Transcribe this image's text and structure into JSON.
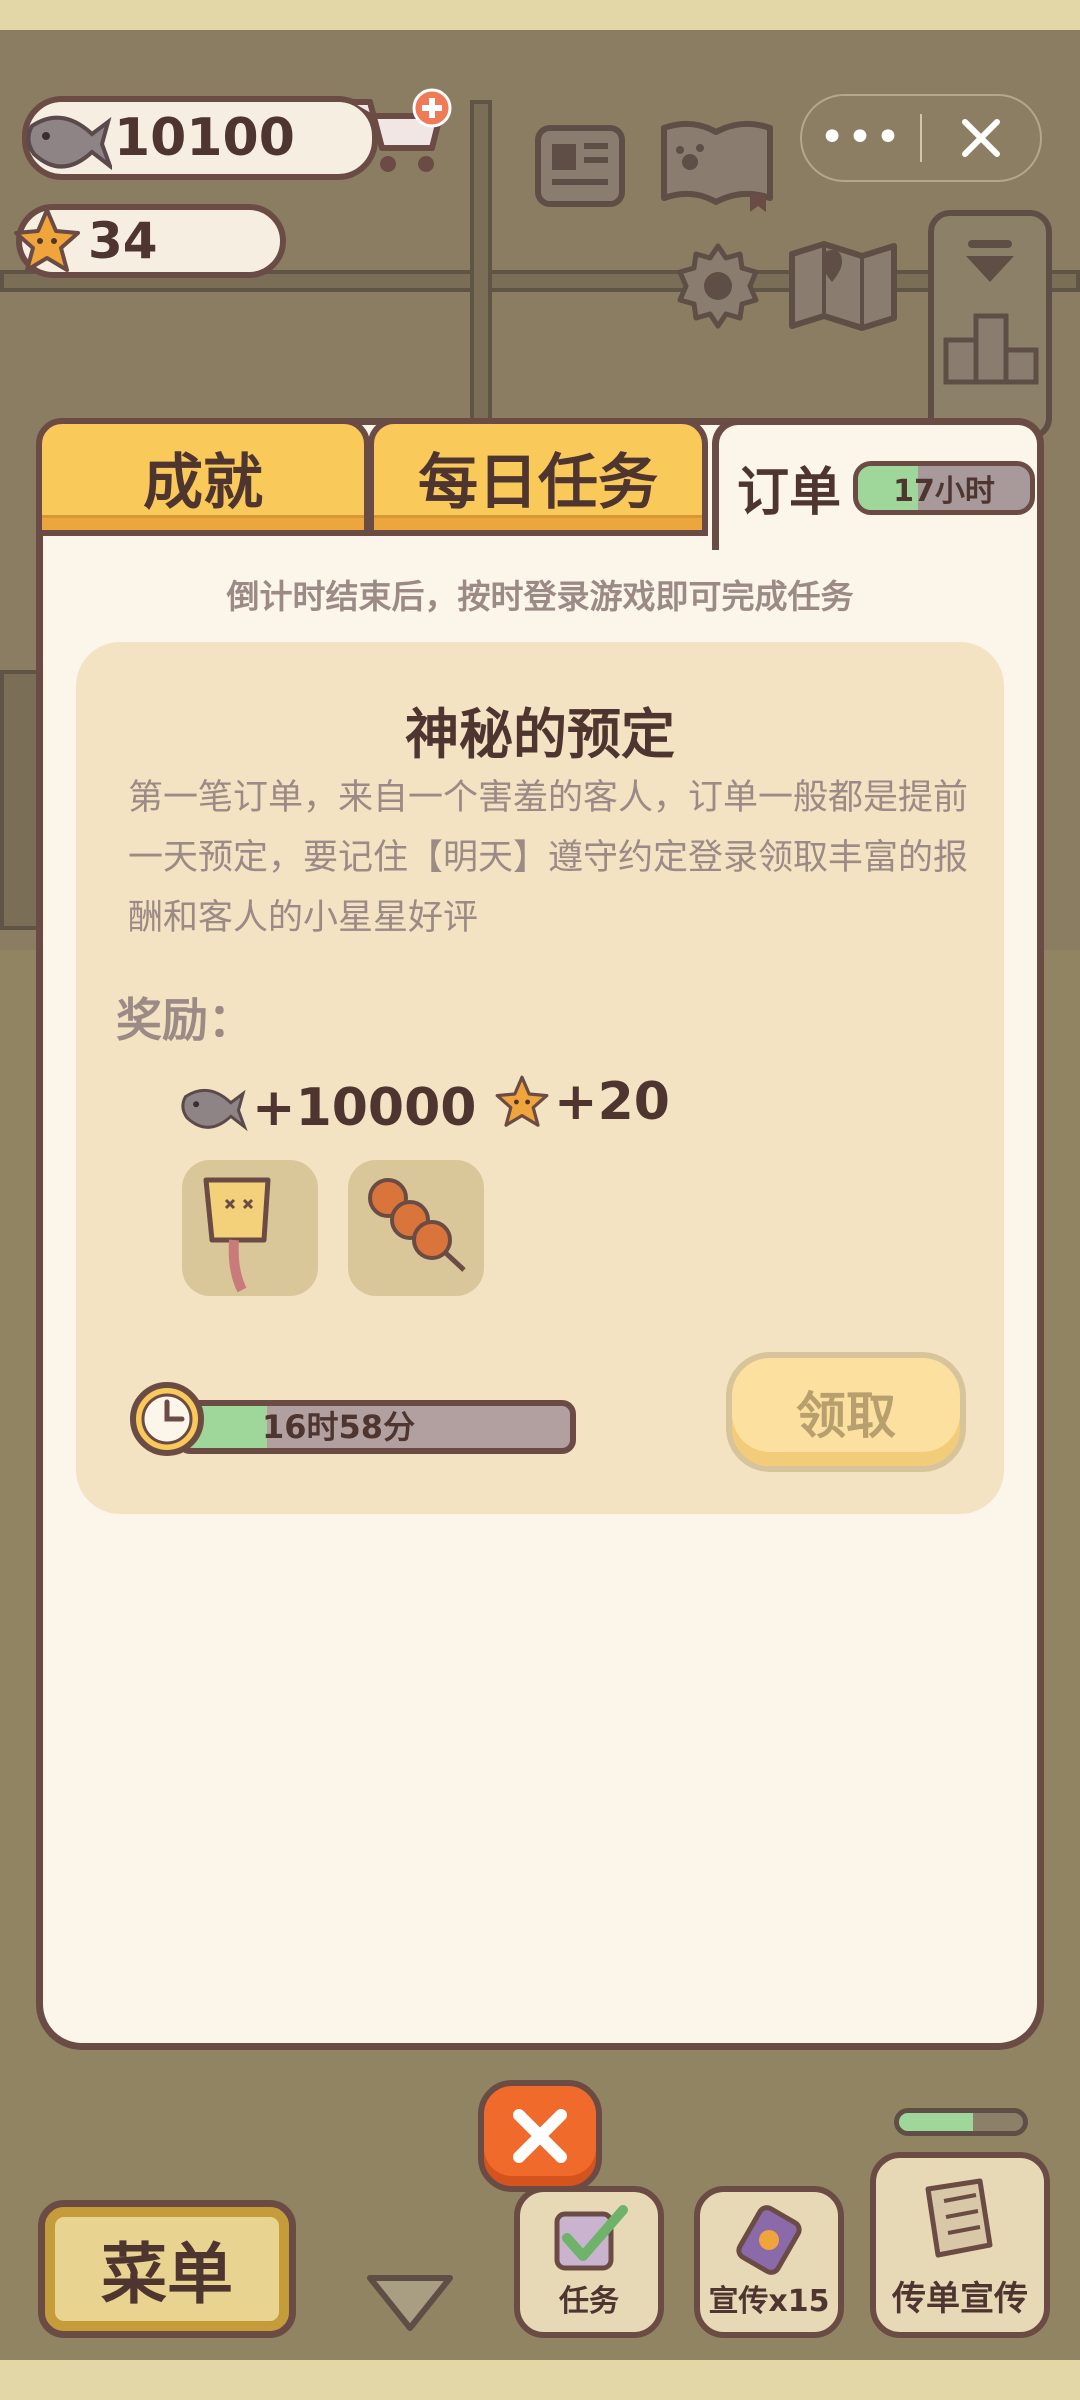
{
  "hud": {
    "fish_count": "10100",
    "star_count": "34",
    "icons": [
      "fish-icon",
      "star-icon",
      "cart-add-icon",
      "newspaper-icon",
      "paw-book-icon",
      "gear-icon",
      "map-icon",
      "dropdown-arrow-icon",
      "podium-ranking-icon"
    ]
  },
  "miniprogram": {
    "more_glyph": "•••",
    "close_icon": "close-x-icon"
  },
  "tabs": {
    "achievement": "成就",
    "daily": "每日任务",
    "order": "订单",
    "order_timer": "17小时",
    "order_timer_progress": 0.35
  },
  "order": {
    "hint": "倒计时结束后，按时登录游戏即可完成任务",
    "title": "神秘的预定",
    "description": "第一笔订单，来自一个害羞的客人，订单一般都是提前一天预定，要记住【明天】遵守约定登录领取丰富的报酬和客人的小星星好评",
    "reward_label": "奖励：",
    "reward_fish": "+10000",
    "reward_stars": "+20",
    "reward_items": [
      "sign-board-item-icon",
      "meatball-skewer-item-icon"
    ],
    "countdown": "16时58分",
    "countdown_progress": 0.22,
    "claim_label": "领取"
  },
  "bottom": {
    "menu_label": "菜单",
    "task_label": "任务",
    "promo_label": "宣传x15",
    "flyer_label": "传单宣传",
    "energy_progress": 0.6
  },
  "colors": {
    "outline": "#6b4c45",
    "tab_yellow": "#f9c95a",
    "panel_bg": "#fbf5ea",
    "card_bg": "#f3e3c2",
    "progress_green": "#9fd79a",
    "close_orange": "#f06a2b",
    "hint_text": "#9c8a86"
  }
}
